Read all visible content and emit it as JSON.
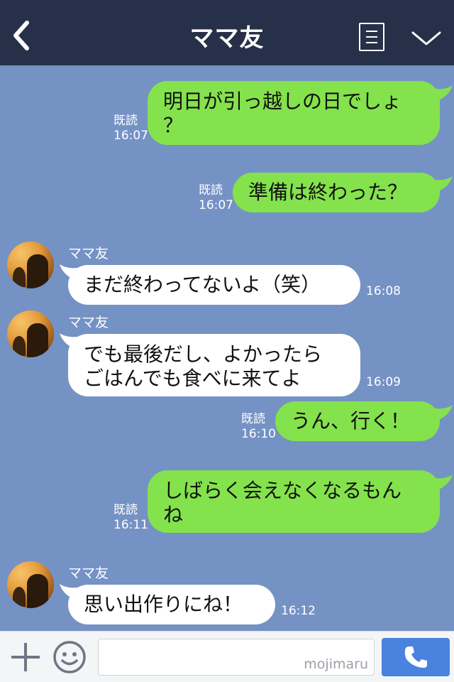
{
  "header": {
    "title": "ママ友",
    "back_icon": "back-chevron-icon",
    "menu_icon": "menu-list-icon",
    "collapse_icon": "chevron-down-icon",
    "background": "#263048"
  },
  "colors": {
    "chat_background": "#7592c4",
    "outgoing_bubble": "#84e24c",
    "incoming_bubble": "#ffffff",
    "call_button": "#4a82e0"
  },
  "messages": [
    {
      "direction": "outgoing",
      "text_lines": [
        "明日が引っ越しの日でしょ",
        "？"
      ],
      "read_label": "既読",
      "time": "16:07"
    },
    {
      "direction": "outgoing",
      "text_lines": [
        "準備は終わった？"
      ],
      "read_label": "既読",
      "time": "16:07"
    },
    {
      "direction": "incoming",
      "sender": "ママ友",
      "text_lines": [
        "まだ終わってないよ（笑）"
      ],
      "time": "16:08"
    },
    {
      "direction": "incoming",
      "sender": "ママ友",
      "text_lines": [
        "でも最後だし、よかったら",
        "ごはんでも食べに来てよ"
      ],
      "time": "16:09"
    },
    {
      "direction": "outgoing",
      "text_lines": [
        "うん、行く！"
      ],
      "read_label": "既読",
      "time": "16:10"
    },
    {
      "direction": "outgoing",
      "text_lines": [
        "しばらく会えなくなるもん",
        "ね"
      ],
      "read_label": "既読",
      "time": "16:11"
    },
    {
      "direction": "incoming",
      "sender": "ママ友",
      "text_lines": [
        "思い出作りにね！"
      ],
      "time": "16:12"
    }
  ],
  "footer": {
    "plus_icon": "plus-icon",
    "emoji_icon": "emoji-smile-icon",
    "input_value": "",
    "watermark": "mojimaru",
    "call_icon": "phone-icon"
  }
}
